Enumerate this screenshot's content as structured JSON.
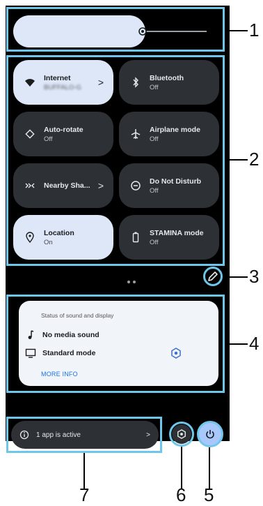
{
  "brightness": {
    "level_fraction": 0.68
  },
  "tiles": [
    {
      "label": "Internet",
      "sub": "BUFFALO-G",
      "active": true,
      "chevron": true,
      "icon": "wifi-icon"
    },
    {
      "label": "Bluetooth",
      "sub": "Off",
      "active": false,
      "chevron": false,
      "icon": "bluetooth-icon"
    },
    {
      "label": "Auto-rotate",
      "sub": "Off",
      "active": false,
      "chevron": false,
      "icon": "rotate-icon"
    },
    {
      "label": "Airplane mode",
      "sub": "Off",
      "active": false,
      "chevron": false,
      "icon": "airplane-icon"
    },
    {
      "label": "Nearby Sha...",
      "sub": "",
      "active": false,
      "chevron": true,
      "icon": "nearby-share-icon"
    },
    {
      "label": "Do Not Disturb",
      "sub": "Off",
      "active": false,
      "chevron": false,
      "icon": "do-not-disturb-icon"
    },
    {
      "label": "Location",
      "sub": "On",
      "active": true,
      "chevron": false,
      "icon": "location-icon"
    },
    {
      "label": "STAMINA mode",
      "sub": "Off",
      "active": false,
      "chevron": false,
      "icon": "battery-icon"
    }
  ],
  "chevron_glyph": ">",
  "sound_display": {
    "header": "Status of sound and display",
    "sound_label": "No media sound",
    "display_label": "Standard mode",
    "more_info": "MORE INFO"
  },
  "footer": {
    "active_apps": "1 app is active",
    "chevron": ">"
  },
  "callouts": {
    "c1": "1",
    "c2": "2",
    "c3": "3",
    "c4": "4",
    "c5": "5",
    "c6": "6",
    "c7": "7"
  },
  "colors": {
    "highlight": "#6ec6ea",
    "tile_on": "#dde7f7",
    "tile_off": "#2d3136",
    "power": "#a8c7fa"
  }
}
